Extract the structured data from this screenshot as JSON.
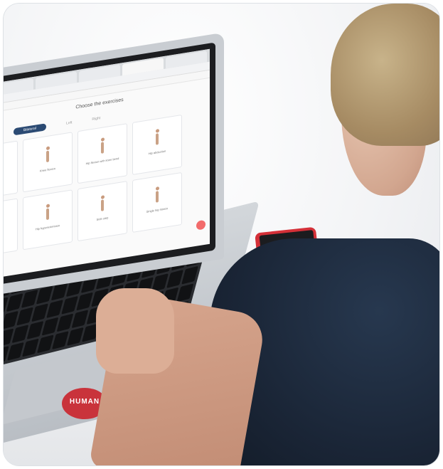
{
  "screen": {
    "title": "Choose the exercises",
    "side_selected": "Bilateral",
    "side_left": "Left",
    "side_right": "Right",
    "cards": [
      {
        "label": "Knee flexion"
      },
      {
        "label": "Hip flexion with knee bend"
      },
      {
        "label": "Hip abduction"
      },
      {
        "label": "Hip hyperextension"
      },
      {
        "label": "Side step"
      },
      {
        "label": "Single leg stance"
      }
    ]
  },
  "sticker_text": "HUMAN",
  "colors": {
    "pill": "#2b4a73",
    "fab": "#f26b6b",
    "phone": "#d43038",
    "sticker": "#c9333b",
    "shirt": "#1a2536"
  }
}
